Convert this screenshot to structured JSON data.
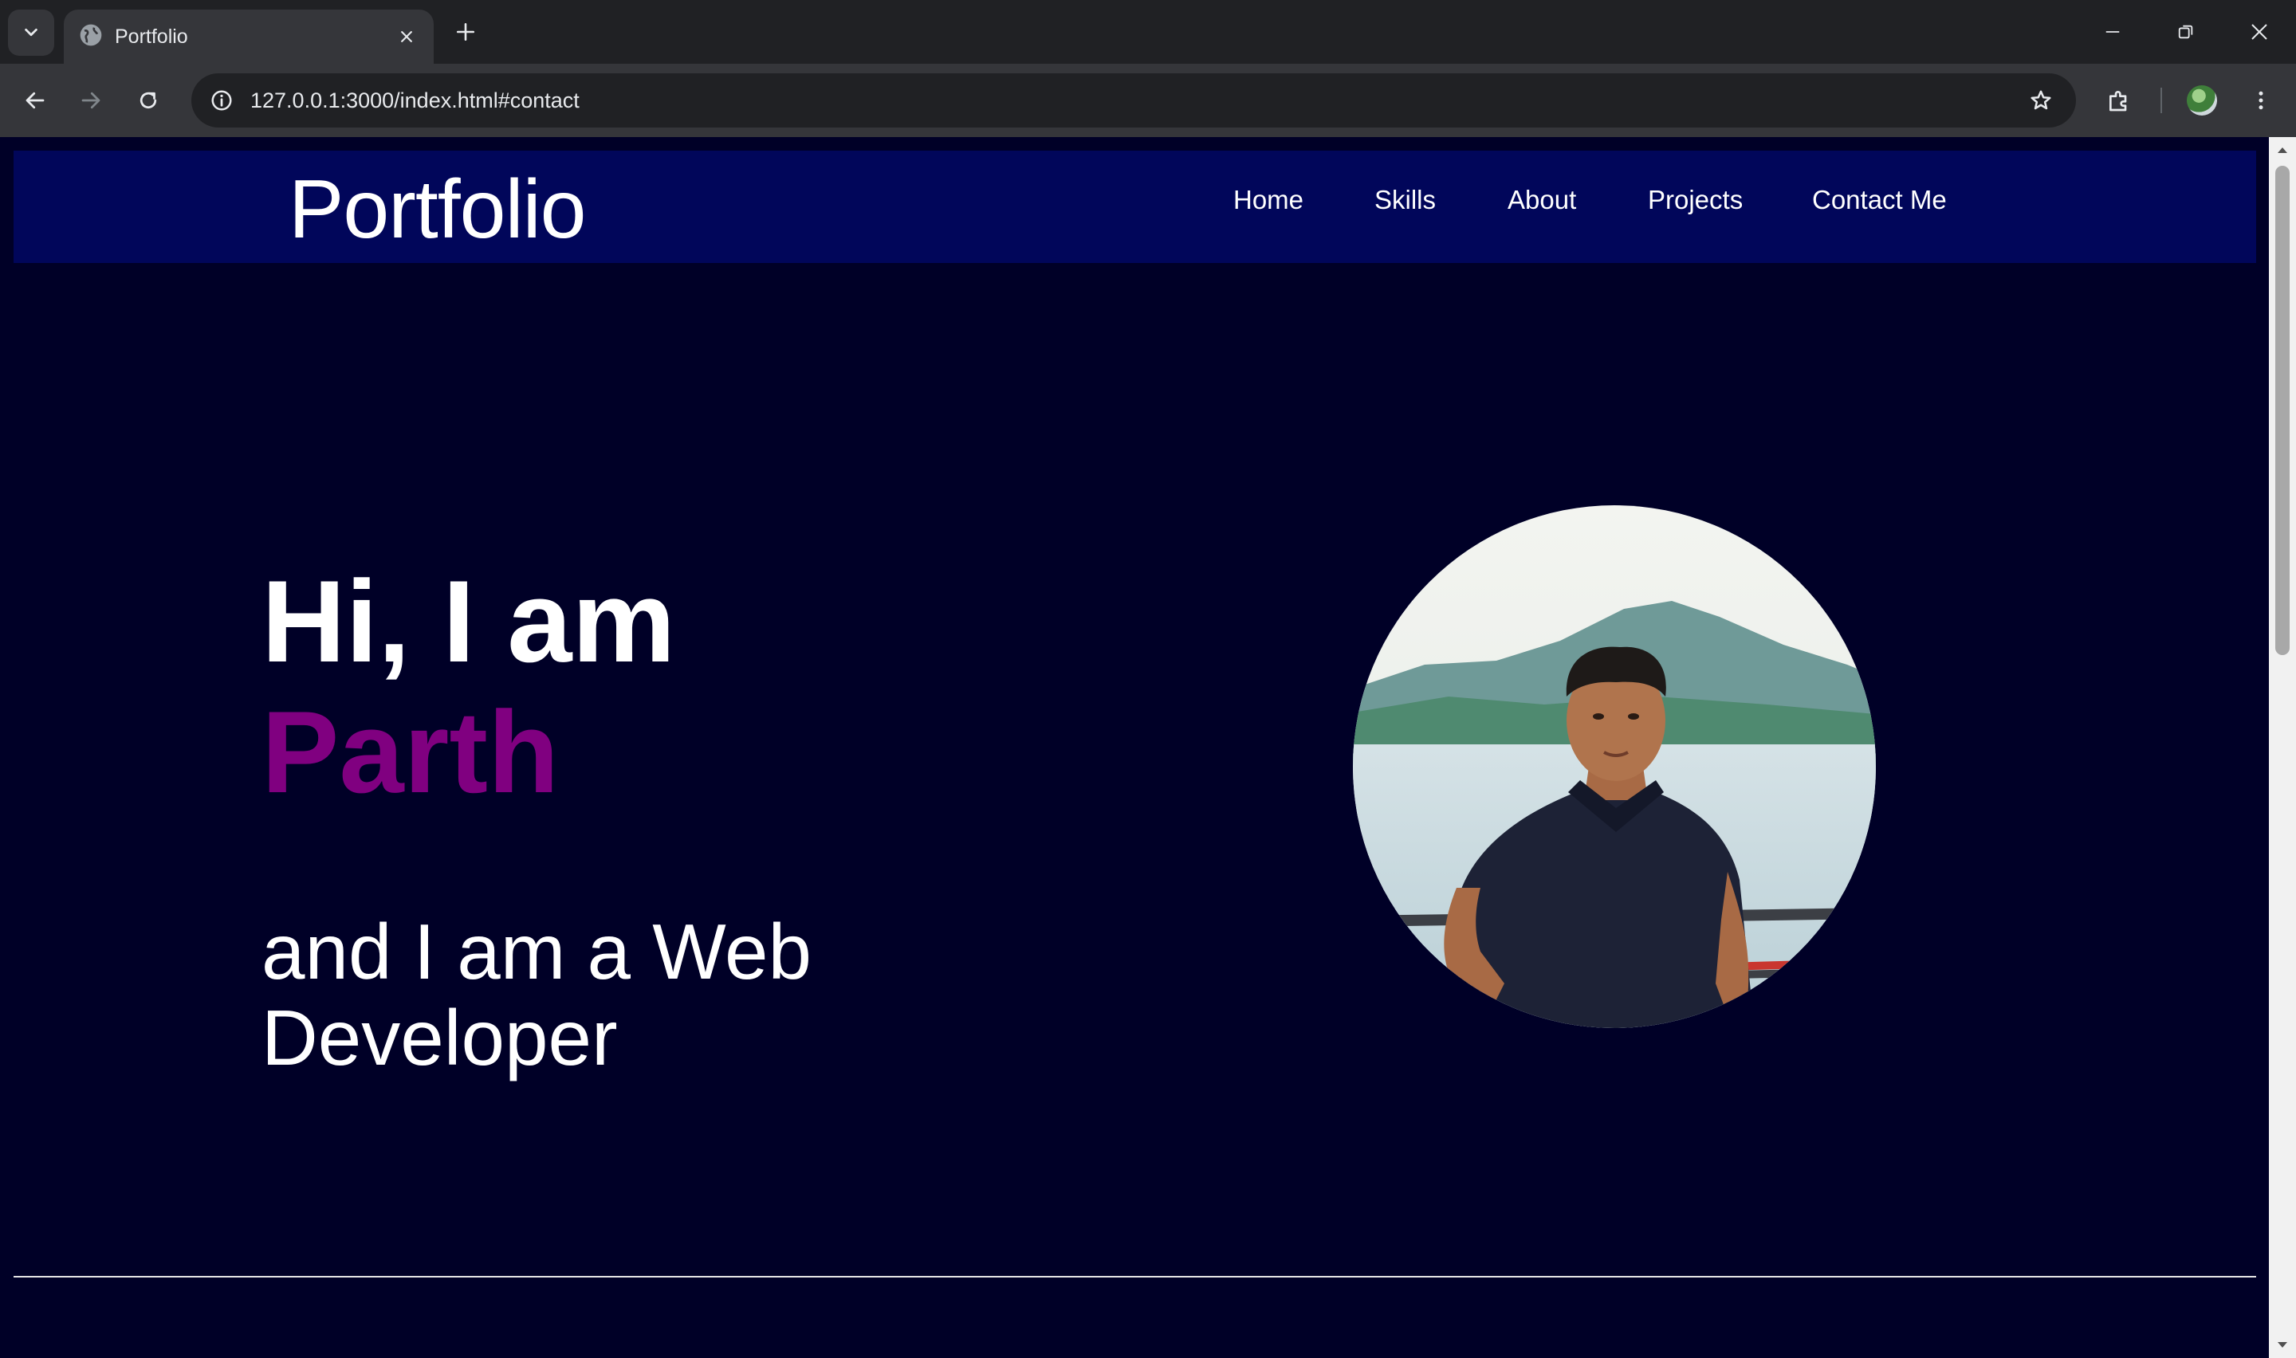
{
  "browser": {
    "tab": {
      "title": "Portfolio",
      "favicon": "globe-icon"
    },
    "address_bar": {
      "url": "127.0.0.1:3000/index.html#contact"
    },
    "icons": {
      "tab_search": "chevron-down-icon",
      "close_tab": "close-icon",
      "new_tab": "plus-icon",
      "back": "arrow-left-icon",
      "forward": "arrow-right-icon",
      "reload": "reload-icon",
      "site_info": "info-icon",
      "bookmark": "star-icon",
      "extensions": "puzzle-icon",
      "menu": "kebab-menu-icon",
      "minimize": "minimize-icon",
      "restore": "restore-icon",
      "close_window": "close-icon"
    },
    "colors": {
      "tab_strip": "#202124",
      "toolbar": "#35363a",
      "omnibox": "#202124",
      "text": "#e8eaed"
    }
  },
  "page": {
    "header": {
      "logo": "Portfolio",
      "nav": [
        {
          "label": "Home"
        },
        {
          "label": "Skills"
        },
        {
          "label": "About"
        },
        {
          "label": "Projects"
        },
        {
          "label": "Contact Me"
        }
      ]
    },
    "hero": {
      "greeting": "Hi, I am",
      "name": "Parth",
      "role_line": "and I am a Web Developer"
    },
    "colors": {
      "background": "#000027",
      "header_background": "#01065a",
      "name_accent": "#800080",
      "text": "#ffffff",
      "divider": "#e6e6e6"
    }
  }
}
